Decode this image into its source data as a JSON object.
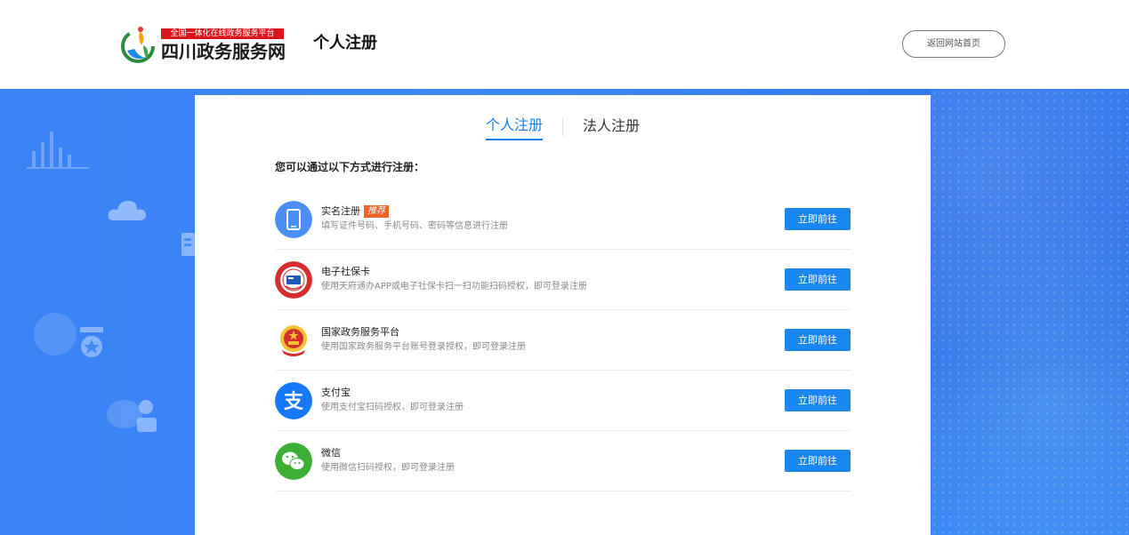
{
  "header": {
    "logo_tag": "全国一体化在线政务服务平台",
    "logo_name": "四川政务服务网",
    "page_title": "个人注册",
    "home_button": "返回网站首页"
  },
  "tabs": [
    {
      "label": "个人注册",
      "active": true
    },
    {
      "label": "法人注册",
      "active": false
    }
  ],
  "intro": "您可以通过以下方式进行注册：",
  "options": [
    {
      "title": "实名注册",
      "badge": "推荐",
      "desc": "填写证件号码、手机号码、密码等信息进行注册",
      "button": "立即前往",
      "icon": "tablet-icon"
    },
    {
      "title": "电子社保卡",
      "badge": "",
      "desc": "使用天府通办APP或电子社保卡扫一扫功能扫码授权，即可登录注册",
      "button": "立即前往",
      "icon": "social-security-card-icon"
    },
    {
      "title": "国家政务服务平台",
      "badge": "",
      "desc": "使用国家政务服务平台账号登录授权，即可登录注册",
      "button": "立即前往",
      "icon": "national-emblem-icon"
    },
    {
      "title": "支付宝",
      "badge": "",
      "desc": "使用支付宝扫码授权，即可登录注册",
      "button": "立即前往",
      "icon": "alipay-icon"
    },
    {
      "title": "微信",
      "badge": "",
      "desc": "使用微信扫码授权，即可登录注册",
      "button": "立即前往",
      "icon": "wechat-icon"
    }
  ],
  "colors": {
    "accent": "#1a86f0",
    "background_blue": "#3b82f6",
    "badge": "#f1612a"
  }
}
